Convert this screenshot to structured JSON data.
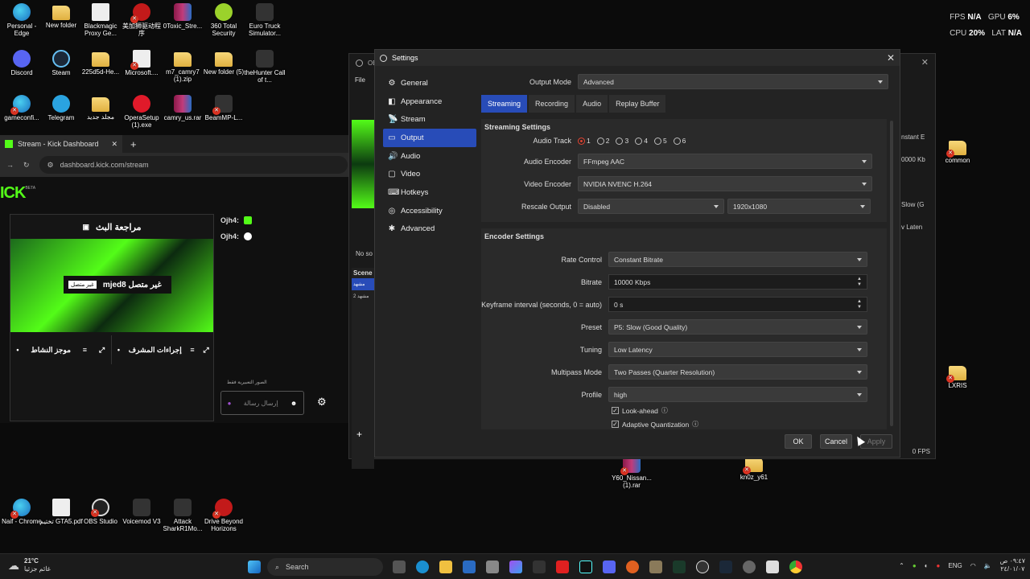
{
  "desktop": {
    "icons": [
      {
        "label": "Personal - Edge",
        "kind": "edge"
      },
      {
        "label": "New folder",
        "kind": "folder"
      },
      {
        "label": "Blackmagic Proxy Ge...",
        "kind": "file"
      },
      {
        "label": "美加狮驱动程序",
        "kind": "red"
      },
      {
        "label": "0Toxic_Stre...",
        "kind": "rar"
      },
      {
        "label": "360 Total Security",
        "kind": "green"
      },
      {
        "label": "Euro Truck Simulator...",
        "kind": "beam"
      },
      {
        "label": "Discord",
        "kind": "discord"
      },
      {
        "label": "Steam",
        "kind": "steam"
      },
      {
        "label": "225d5d-He...",
        "kind": "folder"
      },
      {
        "label": "Microsoft....",
        "kind": "file"
      },
      {
        "label": "m7_camry7 (1).zip",
        "kind": "folder"
      },
      {
        "label": "New folder (5)",
        "kind": "folder"
      },
      {
        "label": "theHunter Call of t...",
        "kind": "beam"
      },
      {
        "label": "gameconfi...",
        "kind": "edge"
      },
      {
        "label": "Telegram",
        "kind": "tele"
      },
      {
        "label": "مجلد جديد",
        "kind": "folder"
      },
      {
        "label": "OperaSetup (1).exe",
        "kind": "opera"
      },
      {
        "label": "camry_us.rar",
        "kind": "rar"
      },
      {
        "label": "BeamMP-L...",
        "kind": "beam"
      },
      {
        "label": "common",
        "kind": "folder"
      },
      {
        "label": "LXRIS",
        "kind": "folder"
      },
      {
        "label": "Y60_Nissan... (1).rar",
        "kind": "rar"
      },
      {
        "label": "kn0z_y61",
        "kind": "folder"
      },
      {
        "label": "Naif - Chrome",
        "kind": "edge"
      },
      {
        "label": "تختيم GTA5.pdf",
        "kind": "file"
      },
      {
        "label": "OBS Studio",
        "kind": "obs"
      },
      {
        "label": "Voicemod V3",
        "kind": "beam"
      },
      {
        "label": "Attack SharkR1Mo...",
        "kind": "beam"
      },
      {
        "label": "Drive Beyond Horizons",
        "kind": "red"
      }
    ]
  },
  "stats": {
    "fps_label": "FPS",
    "fps": "N/A",
    "gpu_label": "GPU",
    "gpu": "6%",
    "cpu_label": "CPU",
    "cpu": "20%",
    "lat_label": "LAT",
    "lat": "N/A"
  },
  "browser": {
    "tab_title": "Stream - Kick Dashboard",
    "url": "dashboard.kick.com/stream",
    "kick_word": "ICK",
    "kick_beta": "BETA",
    "preview_title": "مراجعة البث",
    "offline_badge": "غير متصل",
    "channel": "mjed8 غير متصل",
    "panel1": "موجز النشاط",
    "panel2": "إجراءات المشرف",
    "chat_users": [
      "Ojh4:",
      "Ojh4:"
    ],
    "chat_hint": "الصور التعبيرية فقط",
    "chat_placeholder": "إرسال رسالة"
  },
  "obs_main": {
    "title": "OB",
    "file_menu": "File",
    "no_source": "No so",
    "scenes_header": "Scene",
    "scene_items": [
      "مشهد",
      "مشهد 2"
    ],
    "right_snippets": [
      "nstant E",
      "0000 Kb",
      "Slow (G",
      "v Laten"
    ],
    "fps_footer": "0 FPS"
  },
  "settings": {
    "title": "Settings",
    "nav": [
      {
        "label": "General",
        "icon": "gear-icon",
        "glyph": "⚙"
      },
      {
        "label": "Appearance",
        "icon": "appearance-icon",
        "glyph": "◧"
      },
      {
        "label": "Stream",
        "icon": "stream-icon",
        "glyph": "📡"
      },
      {
        "label": "Output",
        "icon": "output-icon",
        "glyph": "▭"
      },
      {
        "label": "Audio",
        "icon": "audio-icon",
        "glyph": "🔊"
      },
      {
        "label": "Video",
        "icon": "video-icon",
        "glyph": "▢"
      },
      {
        "label": "Hotkeys",
        "icon": "keyboard-icon",
        "glyph": "⌨"
      },
      {
        "label": "Accessibility",
        "icon": "accessibility-icon",
        "glyph": "◎"
      },
      {
        "label": "Advanced",
        "icon": "wrench-icon",
        "glyph": "✱"
      }
    ],
    "active_nav": "Output",
    "output_mode_label": "Output Mode",
    "output_mode": "Advanced",
    "tabs": [
      "Streaming",
      "Recording",
      "Audio",
      "Replay Buffer"
    ],
    "active_tab": "Streaming",
    "streaming_header": "Streaming Settings",
    "audio_track_label": "Audio Track",
    "audio_tracks": [
      "1",
      "2",
      "3",
      "4",
      "5",
      "6"
    ],
    "audio_encoder_label": "Audio Encoder",
    "audio_encoder": "FFmpeg AAC",
    "video_encoder_label": "Video Encoder",
    "video_encoder": "NVIDIA NVENC H.264",
    "rescale_label": "Rescale Output",
    "rescale": "Disabled",
    "rescale_res": "1920x1080",
    "encoder_header": "Encoder Settings",
    "rate_control_label": "Rate Control",
    "rate_control": "Constant Bitrate",
    "bitrate_label": "Bitrate",
    "bitrate": "10000 Kbps",
    "keyframe_label": "Keyframe interval (seconds, 0 = auto)",
    "keyframe": "0 s",
    "preset_label": "Preset",
    "preset": "P5: Slow (Good Quality)",
    "tuning_label": "Tuning",
    "tuning": "Low Latency",
    "multipass_label": "Multipass Mode",
    "multipass": "Two Passes (Quarter Resolution)",
    "profile_label": "Profile",
    "profile": "high",
    "lookahead_label": "Look-ahead",
    "adaptive_label": "Adaptive Quantization",
    "ok": "OK",
    "cancel": "Cancel",
    "apply": "Apply"
  },
  "taskbar": {
    "temp": "21°C",
    "weather": "غائم جزئيا",
    "search": "Search",
    "lang": "ENG",
    "time": "٠٩:٤٧ ص",
    "date": "٢٤/٠١/٠٧"
  }
}
